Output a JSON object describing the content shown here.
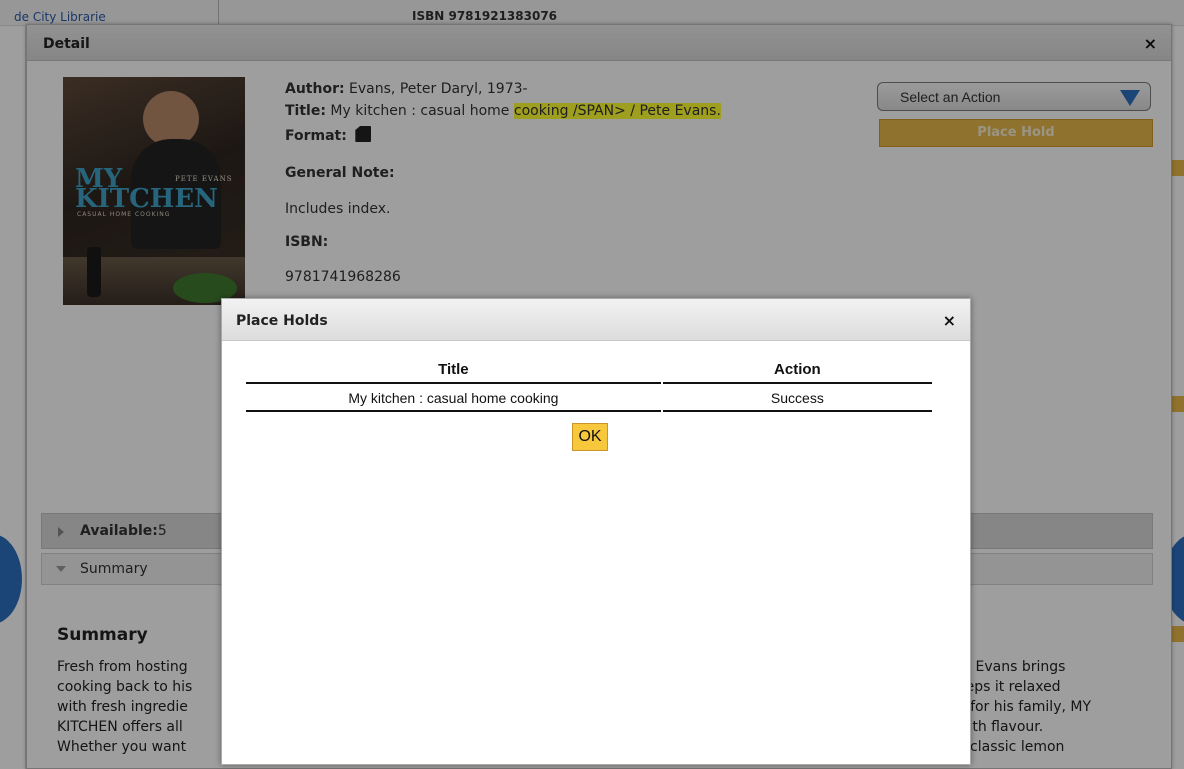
{
  "background": {
    "library_name": "de City Librarie",
    "top_isbn": "ISBN 9781921383076"
  },
  "detail": {
    "title": "Detail",
    "close_glyph": "×",
    "cover": {
      "title_line1": "MY",
      "title_line2": "KITCHEN",
      "author_on_cover": "PETE EVANS",
      "subtitle_on_cover": "CASUAL HOME COOKING"
    },
    "author_label": "Author:",
    "author_value": "Evans, Peter Daryl, 1973-",
    "title_label": "Title:",
    "title_value_plain": "My kitchen : casual home",
    "title_value_highlight": "cooking /SPAN> / Pete Evans.",
    "format_label": "Format:",
    "format_icon": "book-icon",
    "general_note_label": "General Note:",
    "general_note_value": "Includes index.",
    "isbn_label": "ISBN:",
    "isbn_value": "9781741968286",
    "action_select_label": "Select an Action",
    "place_hold_label": "Place Hold",
    "available_label": "Available:",
    "available_count": "5",
    "summary_tab_label": "Summary",
    "summary_heading": "Summary",
    "summary_lines_left": [
      "Fresh from hosting",
      "cooking back to his",
      "with fresh ingredie",
      "KITCHEN offers all",
      "Whether you want"
    ],
    "summary_lines_right": [
      "te Evans brings",
      "eeps it relaxed",
      "e for his family, MY",
      "with flavour.",
      "a classic lemon"
    ]
  },
  "modal": {
    "title": "Place Holds",
    "close_glyph": "×",
    "columns": [
      "Title",
      "Action"
    ],
    "rows": [
      {
        "title": "My kitchen : casual home cooking",
        "action": "Success"
      }
    ],
    "ok_label": "OK"
  },
  "colors": {
    "accent_blue": "#2c6fc1",
    "button_orange": "#e9b84c",
    "ok_yellow": "#f7c73c",
    "highlight_yellow": "#ffff33"
  }
}
